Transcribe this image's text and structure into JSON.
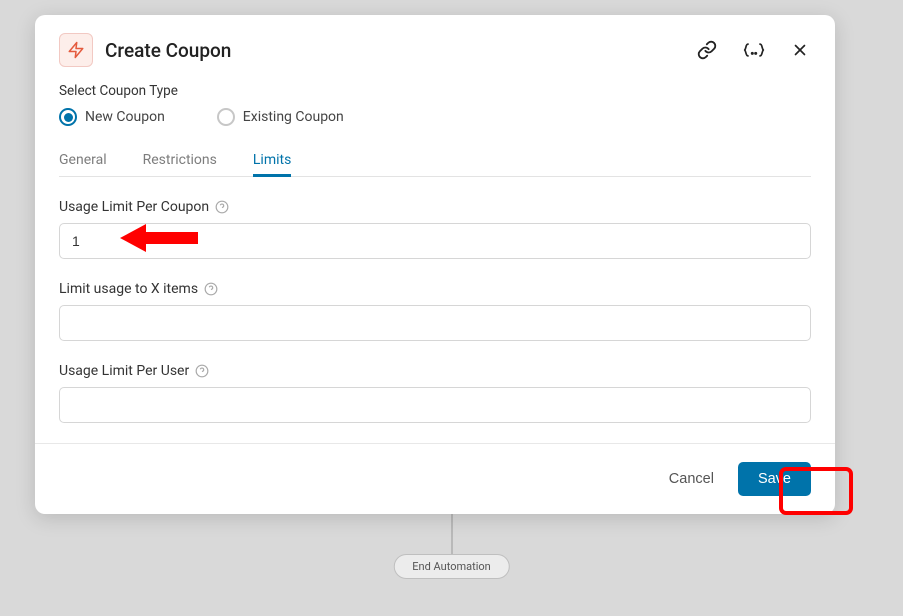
{
  "header": {
    "title": "Create Coupon"
  },
  "coupon_type": {
    "label": "Select Coupon Type",
    "options": {
      "new": "New Coupon",
      "existing": "Existing Coupon"
    },
    "selected": "new"
  },
  "tabs": {
    "general": "General",
    "restrictions": "Restrictions",
    "limits": "Limits",
    "active": "limits"
  },
  "fields": {
    "usage_limit_per_coupon": {
      "label": "Usage Limit Per Coupon",
      "value": "1"
    },
    "limit_usage_x_items": {
      "label": "Limit usage to X items",
      "value": ""
    },
    "usage_limit_per_user": {
      "label": "Usage Limit Per User",
      "value": ""
    }
  },
  "footer": {
    "cancel": "Cancel",
    "save": "Save"
  },
  "backdrop": {
    "end_automation": "End Automation"
  }
}
